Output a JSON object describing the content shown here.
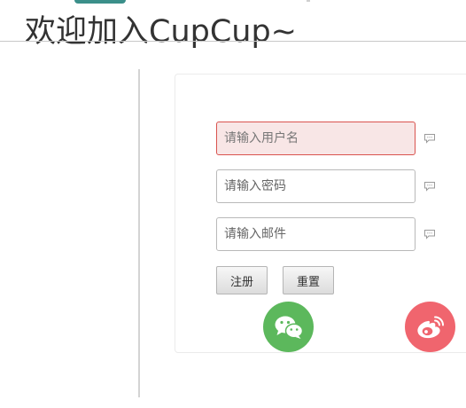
{
  "header": {
    "title": "欢迎加入CupCup~"
  },
  "register_form": {
    "username": {
      "placeholder": "请输入用户名",
      "value": ""
    },
    "password": {
      "placeholder": "请输入密码",
      "value": ""
    },
    "email": {
      "placeholder": "请输入邮件",
      "value": ""
    },
    "register_label": "注册",
    "reset_label": "重置"
  },
  "social": {
    "wechat": {
      "icon": "wechat-icon",
      "color": "#5cb85c"
    },
    "weibo": {
      "icon": "weibo-icon",
      "color": "#f0656e"
    }
  },
  "colors": {
    "error_border": "#d9534f",
    "error_background": "#f8e6e6",
    "top_tab": "#3b8f8a"
  }
}
